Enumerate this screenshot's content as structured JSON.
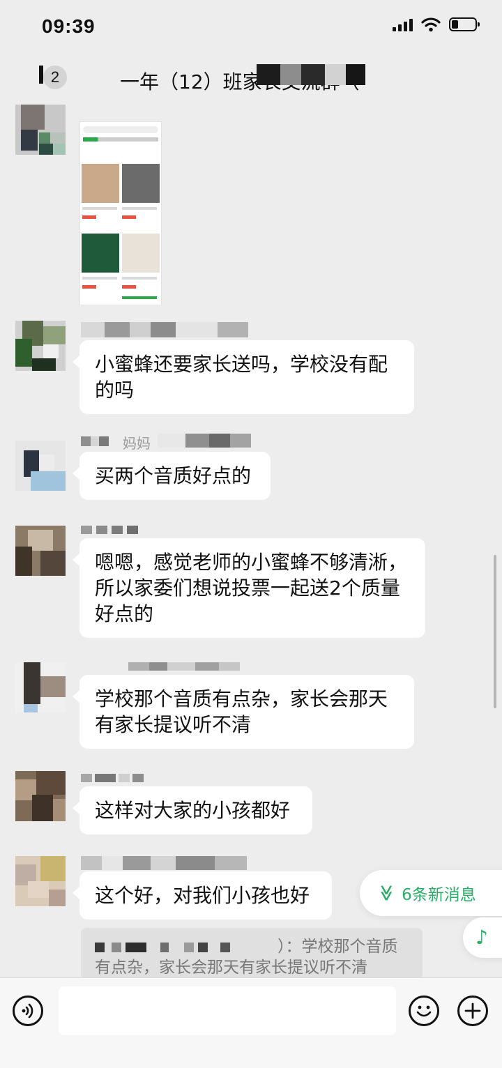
{
  "status_bar": {
    "time": "09:39"
  },
  "header": {
    "back_badge": "2",
    "title": "一年（12）班家长交流群（"
  },
  "messages": [
    {
      "text": "小蜜蜂还要家长送吗，学校没有配的吗"
    },
    {
      "nickname": "妈妈",
      "text": "买两个音质好点的"
    },
    {
      "text": "嗯嗯，感觉老师的小蜜蜂不够清淅，所以家委们想说投票一起送2个质量好点的"
    },
    {
      "text": "学校那个音质有点杂，家长会那天有家长提议听不清"
    },
    {
      "text": "这样对大家的小孩都好"
    },
    {
      "text": "这个好，对我们小孩也好"
    }
  ],
  "quote": {
    "text_tail": "）：学校那个音质",
    "text_line2": "有点杂，家长会那天有家长提议听不清"
  },
  "new_messages": {
    "label": "6条新消息",
    "chevron": "≫"
  },
  "music_fab": {
    "glyph": "♪"
  },
  "input_bar": {
    "voice_icon": "voice-icon",
    "emoji_icon": "emoji-icon",
    "plus_icon": "plus-icon"
  },
  "colors": {
    "background": "#ededed",
    "bubble": "#ffffff",
    "accent_green": "#2aae67"
  }
}
